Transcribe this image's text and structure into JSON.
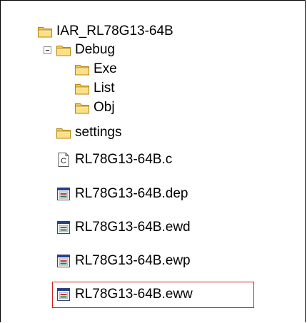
{
  "tree": {
    "root": {
      "label": "IAR_RL78G13-64B",
      "icon": "folder-icon"
    },
    "debug": {
      "label": "Debug",
      "icon": "folder-icon",
      "expanded": true
    },
    "exe": {
      "label": "Exe",
      "icon": "folder-icon"
    },
    "list": {
      "label": "List",
      "icon": "folder-icon"
    },
    "obj": {
      "label": "Obj",
      "icon": "folder-icon"
    },
    "settings": {
      "label": "settings",
      "icon": "folder-icon"
    },
    "file_c": {
      "label": "RL78G13-64B.c",
      "icon": "c-source-file-icon"
    },
    "file_dep": {
      "label": "RL78G13-64B.dep",
      "icon": "iar-project-file-icon"
    },
    "file_ewd": {
      "label": "RL78G13-64B.ewd",
      "icon": "iar-project-file-icon"
    },
    "file_ewp": {
      "label": "RL78G13-64B.ewp",
      "icon": "iar-project-file-icon"
    },
    "file_eww": {
      "label": "RL78G13-64B.eww",
      "icon": "iar-project-file-icon",
      "highlighted": true
    }
  },
  "colors": {
    "folder_fill": "#f7d774",
    "folder_edge": "#c8960c",
    "highlight_border": "#d11f1f"
  }
}
